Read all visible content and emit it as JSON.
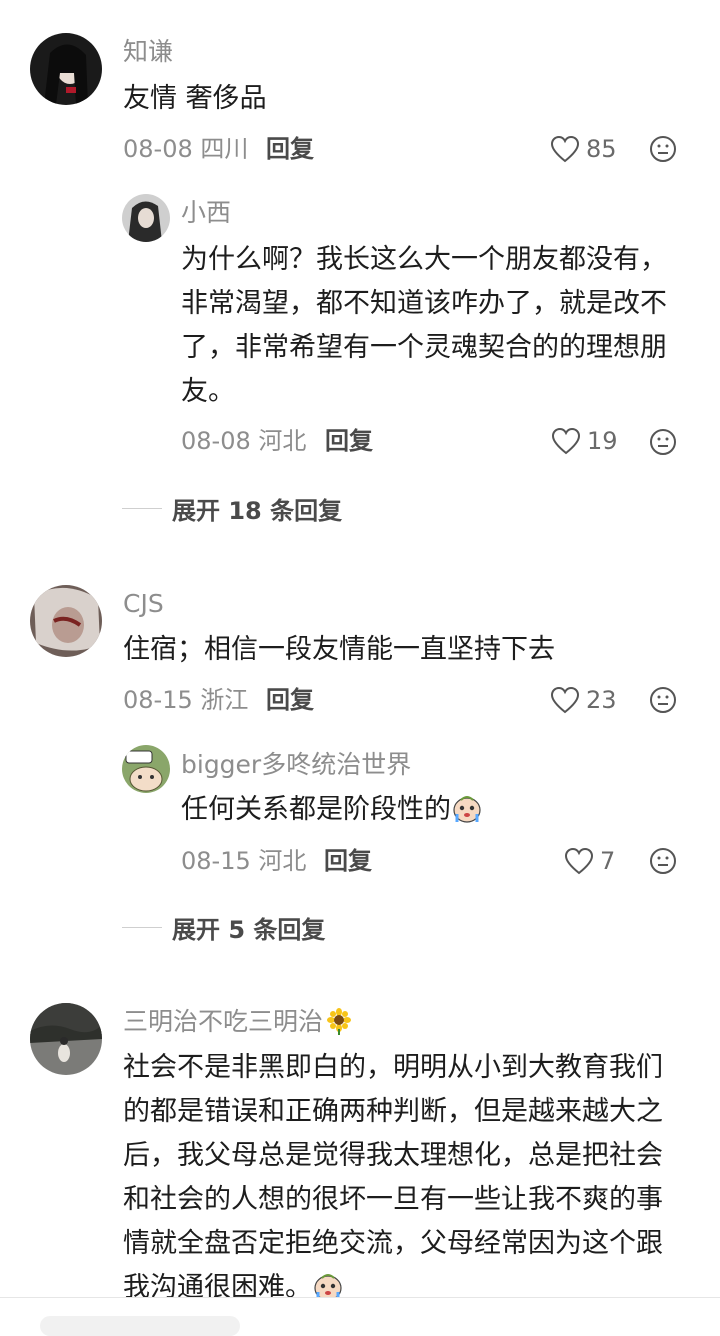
{
  "comments": [
    {
      "name": "知谦",
      "text": "友情 奢侈品",
      "date": "08-08",
      "location": "四川",
      "reply_label": "回复",
      "likes": "85",
      "replies": [
        {
          "name": "小西",
          "text": "为什么啊？我长这么大一个朋友都没有，非常渴望，都不知道该咋办了，就是改不了，非常希望有一个灵魂契合的的理想朋友。",
          "date": "08-08",
          "location": "河北",
          "reply_label": "回复",
          "likes": "19"
        }
      ],
      "expand_label": "展开 18 条回复"
    },
    {
      "name": "CJS",
      "text": "住宿；相信一段友情能一直坚持下去",
      "date": "08-15",
      "location": "浙江",
      "reply_label": "回复",
      "likes": "23",
      "replies": [
        {
          "name": "bigger多咚统治世界",
          "text": "任何关系都是阶段性的",
          "date": "08-15",
          "location": "河北",
          "reply_label": "回复",
          "likes": "7"
        }
      ],
      "expand_label": "展开 5 条回复"
    },
    {
      "name": "三明治不吃三明治",
      "text_lines": [
        "社会不是非黑即白的，明明从小到大教育我们",
        "的都是错误和正确两种判断，但是越来越大之",
        "后，我父母总是觉得我太理想化，总是把社会",
        "和社会的人想的很坏一旦有一些让我不爽的事",
        "情就全盘否定拒绝交流，父母经常因为这个跟",
        "我沟通很困难。"
      ]
    }
  ],
  "reply1_lines": [
    "为什么啊？我长这么大一个朋友都没有，",
    "非常渴望，都不知道该咋办了，就是改不",
    "了，非常希望有一个灵魂契合的的理想朋",
    "友。"
  ],
  "icons": {
    "like": "heart-outline-icon",
    "dislike": "meh-face-icon",
    "crying_emoji": "crying-face-emoji",
    "sunflower": "sunflower-emoji"
  },
  "colors": {
    "name": "#8d8d8d",
    "text": "#1d1d1d",
    "meta": "#8d8d8d"
  }
}
